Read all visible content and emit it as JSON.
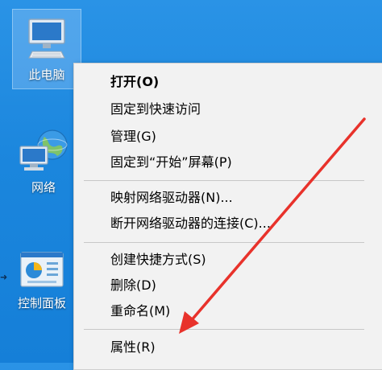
{
  "desktop": {
    "icons": [
      {
        "label": "此电脑",
        "icon": "computer-icon"
      },
      {
        "label": "网络",
        "icon": "network-globe-icon"
      },
      {
        "label": "控制面板",
        "icon": "control-panel-icon"
      }
    ]
  },
  "context_menu": {
    "items": [
      {
        "label": "打开(O)",
        "bold": true
      },
      {
        "label": "固定到快速访问"
      },
      {
        "label": "管理(G)"
      },
      {
        "label": "固定到“开始”屏幕(P)"
      },
      {
        "label": "映射网络驱动器(N)..."
      },
      {
        "label": "断开网络驱动器的连接(C)..."
      },
      {
        "label": "创建快捷方式(S)"
      },
      {
        "label": "删除(D)"
      },
      {
        "label": "重命名(M)"
      },
      {
        "label": "属性(R)"
      }
    ]
  },
  "colors": {
    "desktop_bg": "#1b86dd",
    "menu_bg": "#f2f2f2",
    "annotation_arrow": "#e8322b"
  }
}
